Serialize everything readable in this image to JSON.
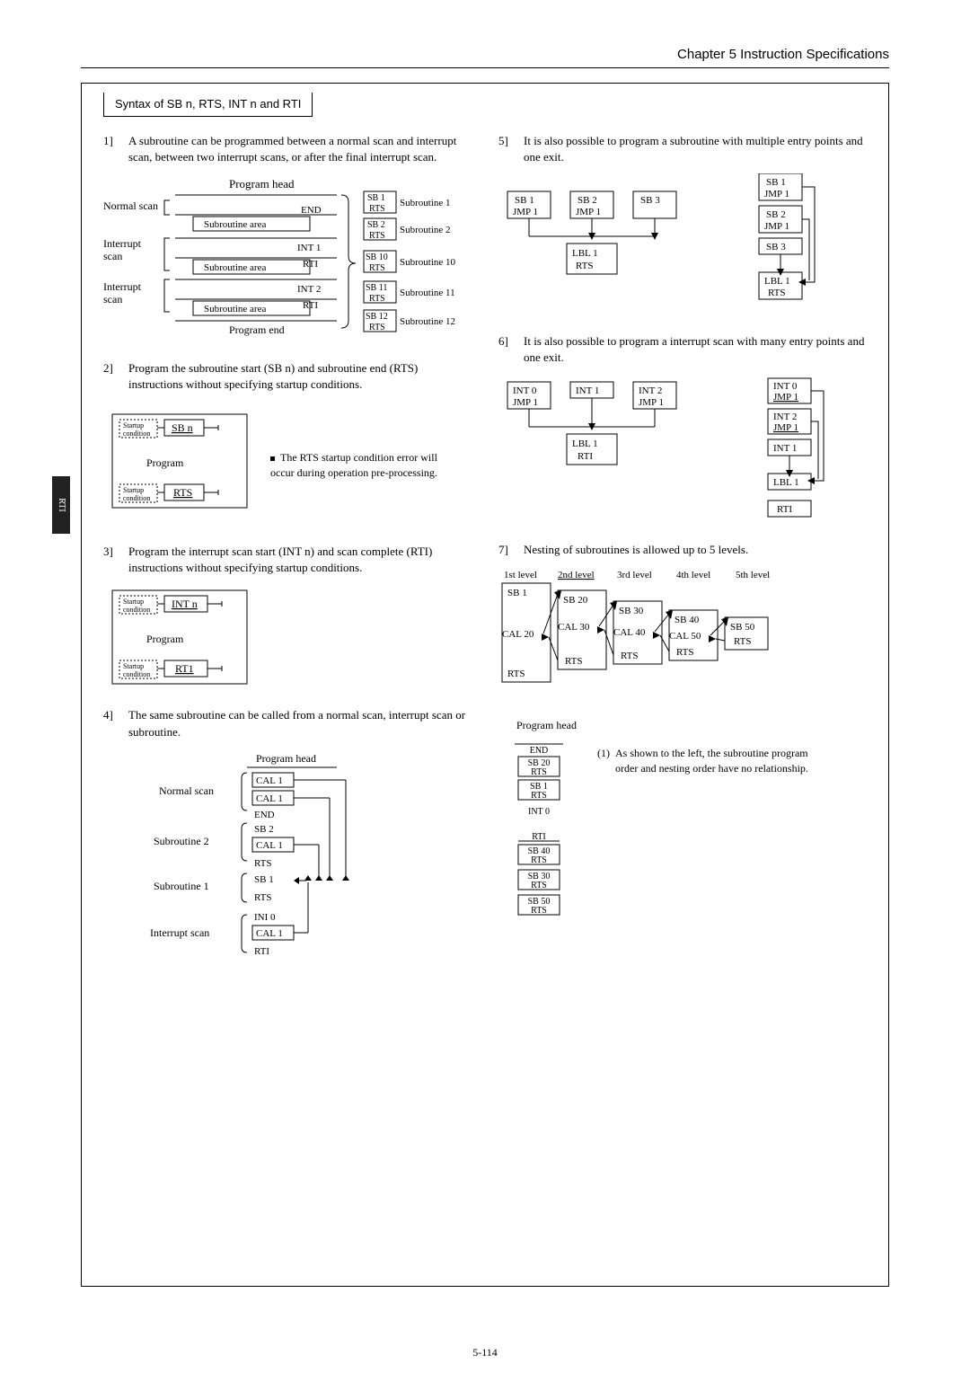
{
  "header": {
    "chapter": "Chapter 5  Instruction Specifications"
  },
  "sidetab": "RTI",
  "title": "Syntax of SB n, RTS, INT n and RTI",
  "pagenum": "5-114",
  "itm1": {
    "n": "1]",
    "t": "A subroutine can be programmed between a normal scan and interrupt scan, between two interrupt scans, or after the final interrupt scan."
  },
  "d1": {
    "normalScan": "Normal scan",
    "interruptScan": "Interrupt\nscan",
    "head": "Program head",
    "end": "END",
    "subArea": "Subroutine area",
    "int1": "INT 1",
    "int2": "INT 2",
    "rti": "RTI",
    "progEnd": "Program end",
    "sb1": "SB 1",
    "sb2": "SB 2",
    "sb10": "SB 10",
    "sb11": "SB 11",
    "sb12": "SB 12",
    "rts": "RTS",
    "s1": "Subroutine 1",
    "s2": "Subroutine 2",
    "s10": "Subroutine 10",
    "s11": "Subroutine 11",
    "s12": "Subroutine 12"
  },
  "itm2": {
    "n": "2]",
    "t": "Program the subroutine start (SB n) and subroutine end (RTS) instructions without specifying startup conditions."
  },
  "d2": {
    "startup": "Startup\ncondition",
    "sbn": "SB n",
    "program": "Program",
    "rts": "RTS",
    "note": "The RTS startup condition error will occur during operation pre-processing."
  },
  "itm3": {
    "n": "3]",
    "t": "Program the interrupt scan start (INT n) and scan complete (RTI) instructions without specifying startup conditions."
  },
  "d3": {
    "startup": "Startup\ncondition",
    "intn": "INT n",
    "program": "Program",
    "rti": "RT1"
  },
  "itm4": {
    "n": "4]",
    "t": "The same subroutine can be called from a normal scan, interrupt scan or subroutine."
  },
  "d4": {
    "head": "Program head",
    "normal": "Normal scan",
    "sub2": "Subroutine 2",
    "sub1": "Subroutine 1",
    "int": "Interrupt scan",
    "cal1": "CAL 1",
    "end": "END",
    "sb2": "SB 2",
    "rts": "RTS",
    "sb1": "SB 1",
    "ini0": "INI 0",
    "rti": "RTI"
  },
  "itm5": {
    "n": "5]",
    "t": "It is also possible to program a subroutine with multiple entry points and one exit."
  },
  "d5": {
    "sb1": "SB 1",
    "sb2": "SB 2",
    "sb3": "SB 3",
    "jmp1": "JMP 1",
    "lbl1": "LBL 1",
    "rts": "RTS"
  },
  "itm6": {
    "n": "6]",
    "t": "It is also possible to program a interrupt scan with many entry points and one exit."
  },
  "d6": {
    "int0": "INT 0",
    "int1": "INT 1",
    "int2": "INT 2",
    "jmp1": "JMP 1",
    "lbl1": "LBL 1",
    "rti": "RTI"
  },
  "itm7": {
    "n": "7]",
    "t": "Nesting of subroutines is allowed up to 5 levels."
  },
  "d7": {
    "l1": "1st level",
    "l2": "2nd level",
    "l3": "3rd level",
    "l4": "4th level",
    "l5": "5th level",
    "sb1": "SB 1",
    "sb20": "SB 20",
    "sb30": "SB 30",
    "sb40": "SB 40",
    "sb50": "SB 50",
    "cal20": "CAL 20",
    "cal30": "CAL 30",
    "cal40": "CAL 40",
    "cal50": "CAL 50",
    "rts": "RTS"
  },
  "d8": {
    "head": "Program head",
    "end": "END",
    "sb20": "SB 20",
    "rts": "RTS",
    "sb1": "SB 1",
    "int0": "INT 0",
    "rti": "RTI",
    "sb40": "SB 40",
    "sb30": "SB 30",
    "sb50": "SB 50",
    "note_n": "(1)",
    "note": "As shown to the left, the subroutine program order and nesting order have no relationship."
  }
}
